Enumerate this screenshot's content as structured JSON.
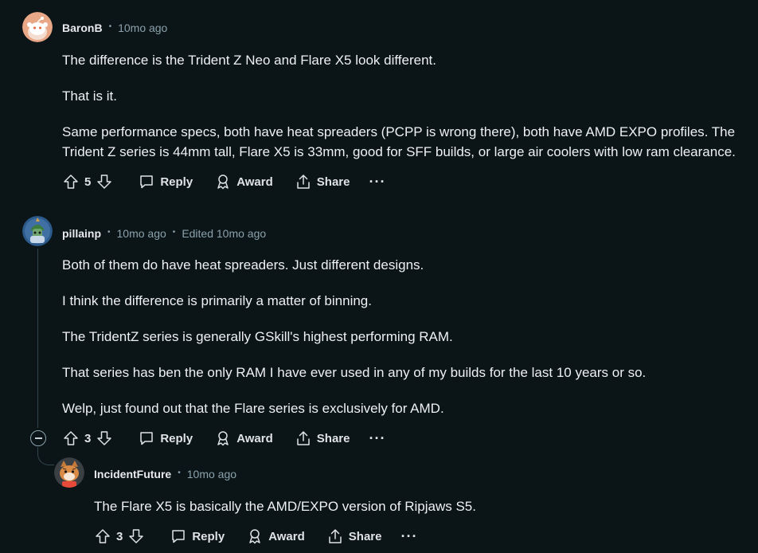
{
  "comments": [
    {
      "author": "BaronB",
      "time": "10mo ago",
      "paragraphs": [
        "The difference is the Trident Z Neo and Flare X5 look different.",
        "That is it.",
        "Same performance specs, both have heat spreaders (PCPP is wrong there), both have AMD EXPO profiles. The Trident Z series is 44mm tall, Flare X5 is 33mm, good for SFF builds, or large air coolers with low ram clearance."
      ],
      "votes": "5",
      "reply_label": "Reply",
      "award_label": "Award",
      "share_label": "Share",
      "more_label": "···"
    },
    {
      "author": "pillainp",
      "time": "10mo ago",
      "edited": "Edited 10mo ago",
      "paragraphs": [
        "Both of them do have heat spreaders. Just different designs.",
        "I think the difference is primarily a matter of binning.",
        "The TridentZ series is generally GSkill's highest performing RAM.",
        "That series has ben the only RAM I have ever used in any of my builds for the last 10 years or so.",
        "Welp, just found out that the Flare series is exclusively for AMD."
      ],
      "votes": "3",
      "reply_label": "Reply",
      "award_label": "Award",
      "share_label": "Share",
      "more_label": "···"
    },
    {
      "author": "IncidentFuture",
      "time": "10mo ago",
      "paragraphs": [
        "The Flare X5 is basically the AMD/EXPO version of Ripjaws S5."
      ],
      "votes": "3",
      "reply_label": "Reply",
      "award_label": "Award",
      "share_label": "Share",
      "more_label": "···"
    }
  ],
  "icons": {
    "upvote": "upvote-icon",
    "downvote": "downvote-icon",
    "reply": "comment-bubble-icon",
    "award": "award-icon",
    "share": "share-icon",
    "collapse": "collapse-icon"
  },
  "colors": {
    "background": "#0b1416",
    "text": "#eef1f3",
    "meta": "#8ba2ad",
    "thread_line": "#33464c"
  }
}
